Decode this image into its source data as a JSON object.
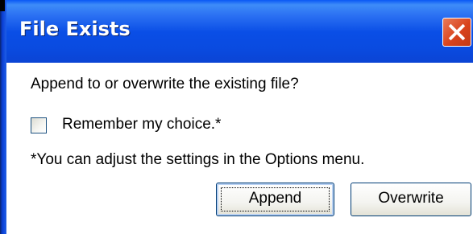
{
  "window": {
    "title": "File Exists"
  },
  "dialog": {
    "question": "Append to or overwrite the existing file?",
    "remember_label": "Remember my choice.*",
    "remember_checked": false,
    "note": "*You can adjust the settings in the Options menu."
  },
  "buttons": {
    "append_label": "Append",
    "overwrite_label": "Overwrite"
  },
  "icons": {
    "close": "close-icon",
    "checkbox": "checkbox-icon"
  },
  "colors": {
    "titlebar": "#0a4ee6",
    "close_button": "#d9431c",
    "text": "#000000"
  }
}
